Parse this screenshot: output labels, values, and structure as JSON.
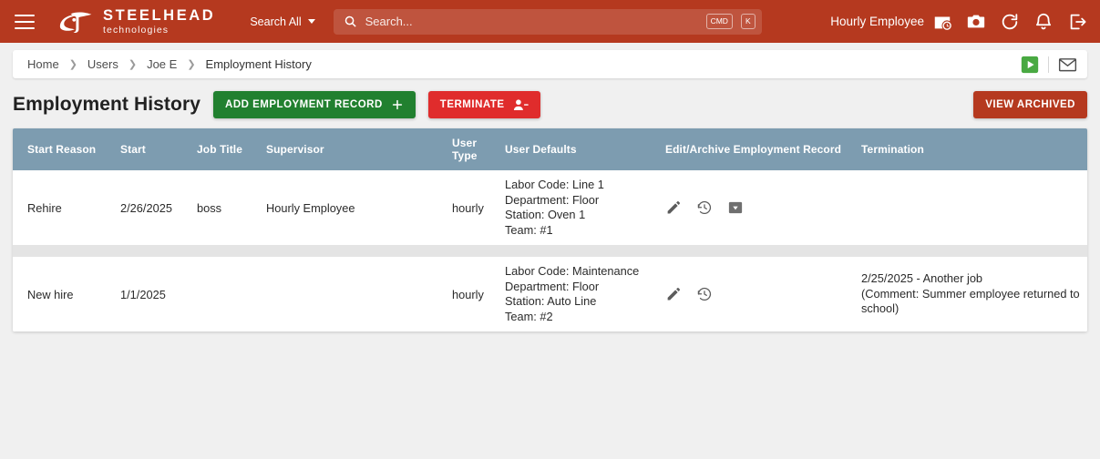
{
  "appbar": {
    "menu_icon": "hamburger-menu-icon",
    "brand_name": "STEELHEAD",
    "brand_sub": "technologies",
    "search_scope_label": "Search All",
    "search_placeholder": "Search...",
    "kbd_cmd": "CMD",
    "kbd_key": "K",
    "user_label": "Hourly Employee",
    "icons": [
      "timecard-icon",
      "camera-icon",
      "refresh-icon",
      "notifications-bell-icon",
      "logout-icon"
    ]
  },
  "breadcrumb": {
    "items": [
      "Home",
      "Users",
      "Joe E",
      "Employment History"
    ],
    "separator": "❯",
    "actions": [
      "play-icon",
      "mail-icon"
    ]
  },
  "page": {
    "title": "Employment History",
    "add_record_label": "ADD EMPLOYMENT RECORD",
    "terminate_label": "TERMINATE",
    "view_archived_label": "VIEW ARCHIVED"
  },
  "table": {
    "columns": [
      "Start Reason",
      "Start",
      "Job Title",
      "Supervisor",
      "User Type",
      "User Defaults",
      "Edit/Archive Employment Record",
      "Termination"
    ],
    "rows": [
      {
        "start_reason": "Rehire",
        "start": "2/26/2025",
        "job_title": "boss",
        "supervisor": "Hourly Employee",
        "user_type": "hourly",
        "user_defaults": [
          "Labor Code: Line 1",
          "Department: Floor",
          "Station: Oven 1",
          "Team: #1"
        ],
        "actions": [
          "edit-pencil-icon",
          "history-clock-icon",
          "archive-icon"
        ],
        "termination": []
      },
      {
        "start_reason": "New hire",
        "start": "1/1/2025",
        "job_title": "",
        "supervisor": "",
        "user_type": "hourly",
        "user_defaults": [
          "Labor Code: Maintenance",
          "Department: Floor",
          "Station: Auto Line",
          "Team: #2"
        ],
        "actions": [
          "edit-pencil-icon",
          "history-clock-icon"
        ],
        "termination": [
          "2/25/2025 - Another job",
          "(Comment: Summer employee returned to school)"
        ]
      }
    ]
  },
  "colors": {
    "brand_red": "#b5391f",
    "green": "#21802f",
    "terminate_red": "#e02c2c",
    "table_header": "#7d9cb0",
    "row_spacer": "#e4e4e4",
    "page_bg": "#f0f0f0"
  }
}
